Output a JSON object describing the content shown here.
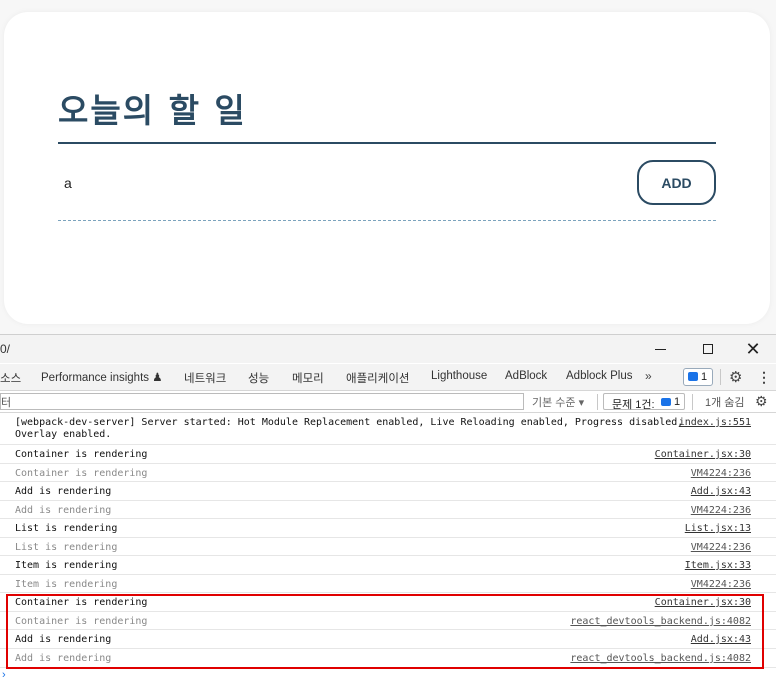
{
  "app": {
    "title": "오늘의 할 일",
    "input_value": "a",
    "add_label": "ADD"
  },
  "devtools": {
    "url_fragment": "0/",
    "window_controls": {
      "minimize": "minimize-icon",
      "maximize": "maximize-icon",
      "close": "✕"
    },
    "tabs": [
      "소스",
      "Performance insights ♟",
      "네트워크",
      "성능",
      "메모리",
      "애플리케이션",
      "Lighthouse",
      "AdBlock",
      "Adblock Plus"
    ],
    "more_tabs": "»",
    "issues_badge": "1",
    "filter_fragment": "터",
    "level_select": "기본 수준 ▾",
    "issues_label": "문제 1건:",
    "issues_num": "1",
    "hidden_count": "1개 숨김",
    "logs": [
      {
        "msg": "[webpack-dev-server] Server started: Hot Module Replacement enabled, Live Reloading enabled, Progress disabled,\nOverlay enabled.",
        "src": "index.js:551",
        "dim": false
      },
      {
        "msg": "Container is rendering",
        "src": "Container.jsx:30",
        "dim": false
      },
      {
        "msg": "Container is rendering",
        "src": "VM4224:236",
        "dim": true
      },
      {
        "msg": "Add is rendering",
        "src": "Add.jsx:43",
        "dim": false
      },
      {
        "msg": "Add is rendering",
        "src": "VM4224:236",
        "dim": true
      },
      {
        "msg": "List is rendering",
        "src": "List.jsx:13",
        "dim": false
      },
      {
        "msg": "List is rendering",
        "src": "VM4224:236",
        "dim": true
      },
      {
        "msg": "Item is rendering",
        "src": "Item.jsx:33",
        "dim": false
      },
      {
        "msg": "Item is rendering",
        "src": "VM4224:236",
        "dim": true
      },
      {
        "msg": "Container is rendering",
        "src": "Container.jsx:30",
        "dim": false
      },
      {
        "msg": "Container is rendering",
        "src": "react_devtools_backend.js:4082",
        "dim": true
      },
      {
        "msg": "Add is rendering",
        "src": "Add.jsx:43",
        "dim": false
      },
      {
        "msg": "Add is rendering",
        "src": "react_devtools_backend.js:4082",
        "dim": true
      }
    ],
    "prompt": "›",
    "colors": {
      "accent": "#2b4b63",
      "highlight": "#e00000",
      "link_blue": "#1a73e8"
    }
  }
}
